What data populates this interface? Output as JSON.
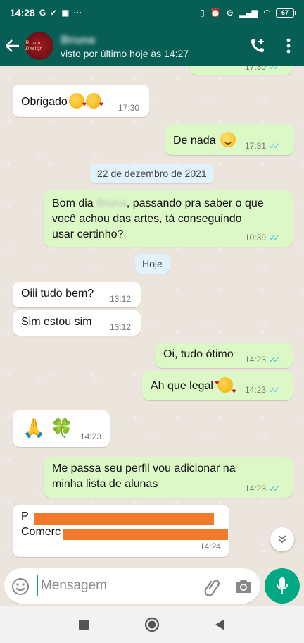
{
  "status_bar": {
    "time": "14:28",
    "left_icons": [
      "google-g-icon",
      "location-icon",
      "shopping-bag-icon",
      "more-dots-icon"
    ],
    "right_icons": [
      "vibrate-icon",
      "alarm-icon",
      "dnd-icon",
      "signal-icon",
      "wifi-icon"
    ],
    "battery": "67"
  },
  "header": {
    "contact_name": "Bruna",
    "avatar_text": "Bruna Design",
    "last_seen": "visto por último hoje às 14:27"
  },
  "chat": {
    "messages": [
      {
        "direction": "out",
        "text": "",
        "time": "17:30",
        "partial": true
      },
      {
        "direction": "in",
        "text": "Obrigado",
        "emoji": [
          "kissing-heart-emoji",
          "kissing-heart-emoji"
        ],
        "time": "17:30"
      },
      {
        "direction": "out",
        "text": "De nada",
        "emoji": [
          "smiling-face-emoji"
        ],
        "time": "17:31"
      },
      {
        "direction": "out",
        "text_before": "Bom dia",
        "blurred_name": "Bruna",
        "text_after": ", passando pra saber o que\nvocê achou das artes, tá conseguindo\nusar certinho?",
        "time": "10:39"
      },
      {
        "direction": "in",
        "text": "Oiii tudo bem?",
        "time": "13:12"
      },
      {
        "direction": "in",
        "text": "Sim estou sim",
        "time": "13:12"
      },
      {
        "direction": "out",
        "text": "Oi, tudo ótimo",
        "time": "14:23"
      },
      {
        "direction": "out",
        "text": "Ah que legal",
        "emoji": [
          "smiling-face-with-hearts-emoji"
        ],
        "time": "14:23"
      },
      {
        "direction": "in",
        "text": "🙏 🍀",
        "time": "14:23"
      },
      {
        "direction": "out",
        "text": "Me passa seu perfil vou adicionar na\nminha lista de alunas",
        "time": "14:23"
      },
      {
        "direction": "in",
        "text": "P\nComerc",
        "time": "14:24",
        "redacted": true
      }
    ],
    "date_chips": [
      "22 de dezembro de 2021",
      "Hoje"
    ]
  },
  "input": {
    "placeholder": "Mensagem"
  },
  "colors": {
    "header": "#075e54",
    "outgoing_bubble": "#dcf8c6",
    "incoming_bubble": "#ffffff",
    "read_ticks": "#4fc3f7",
    "mic_button": "#00a884",
    "redaction": "#f47a2b"
  }
}
